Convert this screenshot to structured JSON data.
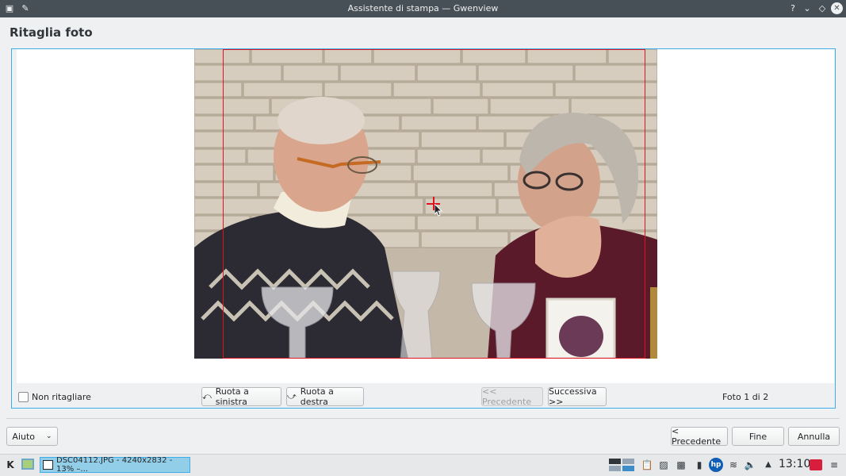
{
  "window": {
    "title": "Assistente di stampa — Gwenview"
  },
  "page": {
    "title": "Ritaglia foto"
  },
  "controls": {
    "no_crop_label": "Non ritagliare",
    "rotate_left": "Ruota a sinistra",
    "rotate_right": "Ruota a destra",
    "previous": "<< Precedente",
    "next": "Successiva >>",
    "photo_counter": "Foto 1 di 2"
  },
  "footer": {
    "help": "Aiuto",
    "back": "< Precedente",
    "finish": "Fine",
    "cancel": "Annulla"
  },
  "taskbar": {
    "task_label": "DSC04112.JPG - 4240x2832 - 13% –...",
    "clock": "13:10"
  },
  "colors": {
    "accent": "#3daee9",
    "crop": "#e0141e",
    "titlebar": "#475057"
  }
}
